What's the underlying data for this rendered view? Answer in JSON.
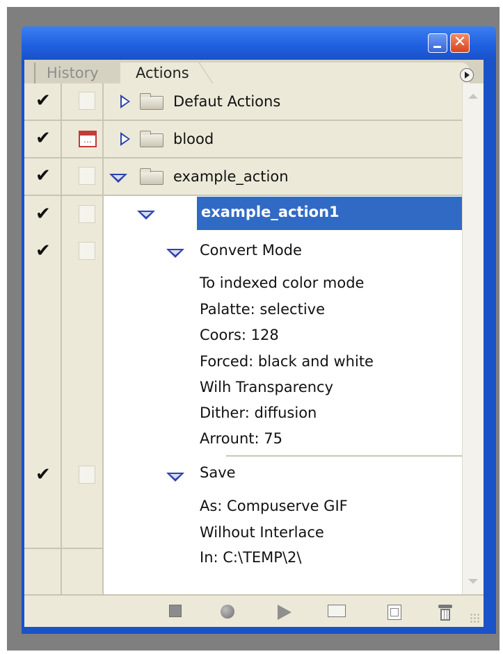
{
  "window": {
    "minimize_icon": "minimize-icon",
    "close_icon": "close-icon",
    "close_glyph": "✕"
  },
  "tabs": [
    {
      "label": "History",
      "active": false
    },
    {
      "label": "Actions",
      "active": true
    }
  ],
  "check_glyph": "✔",
  "rows": [
    {
      "kind": "set",
      "label": "Defaut Actions",
      "checked": true,
      "dialog": false,
      "expanded": false
    },
    {
      "kind": "set",
      "label": "blood",
      "checked": true,
      "dialog": true,
      "expanded": false
    },
    {
      "kind": "set",
      "label": "example_action",
      "checked": true,
      "dialog": false,
      "expanded": true
    },
    {
      "kind": "action",
      "label": "example_action1",
      "checked": true,
      "selected": true,
      "expanded": true
    },
    {
      "kind": "command",
      "label": "Convert Mode",
      "checked": true,
      "expanded": true,
      "details": [
        "To  indexed color mode",
        "Palatte: selective",
        "Coors: 128",
        "Forced: black and white",
        "Wilh Transparency",
        "Dither: diffusion",
        "Arrount: 75"
      ]
    },
    {
      "kind": "command",
      "label": "Save",
      "checked": true,
      "expanded": true,
      "details": [
        "As: Compuserve GIF",
        "Wilhout Interlace",
        "In: C:\\TEMP\\2\\"
      ]
    }
  ],
  "toolbar": {
    "icons": [
      "stop-icon",
      "record-icon",
      "play-icon",
      "new-set-icon",
      "new-action-icon",
      "trash-icon"
    ]
  },
  "colors": {
    "titlebar": "#1a52c8",
    "selection": "#316ac5",
    "expander": "#2b44b0",
    "panel": "#ece9d8"
  }
}
